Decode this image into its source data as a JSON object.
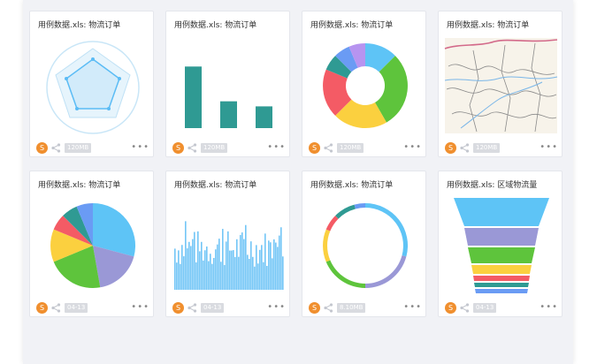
{
  "cards": [
    {
      "title": "用例数据.xls: 物流订单",
      "size": "120MB",
      "chart": "radar"
    },
    {
      "title": "用例数据.xls: 物流订单",
      "size": "120MB",
      "chart": "bar",
      "chart_data": {
        "type": "bar",
        "values": [
          85,
          37,
          30
        ],
        "ylim": [
          0,
          100
        ]
      }
    },
    {
      "title": "用例数据.xls: 物流订单",
      "size": "120MB",
      "chart": "donut"
    },
    {
      "title": "用例数据.xls: 物流订单",
      "size": "120MB",
      "chart": "map"
    },
    {
      "title": "用例数据.xls: 物流订单",
      "size": "04-13",
      "chart": "pie"
    },
    {
      "title": "用例数据.xls: 物流订单",
      "size": "04-13",
      "chart": "area"
    },
    {
      "title": "用例数据.xls: 物流订单",
      "size": "8.10MB",
      "chart": "ring"
    },
    {
      "title": "用例数据.xls: 区域物流量",
      "size": "04-13",
      "chart": "funnel"
    }
  ],
  "footer": {
    "avatar_letter": "S",
    "more_label": "•••"
  },
  "icons": {
    "share": "share-icon",
    "more": "more-icon"
  },
  "colors": {
    "avatar": "#f08f2e",
    "teal": "#2f9a93",
    "sky": "#5bbcf5"
  }
}
